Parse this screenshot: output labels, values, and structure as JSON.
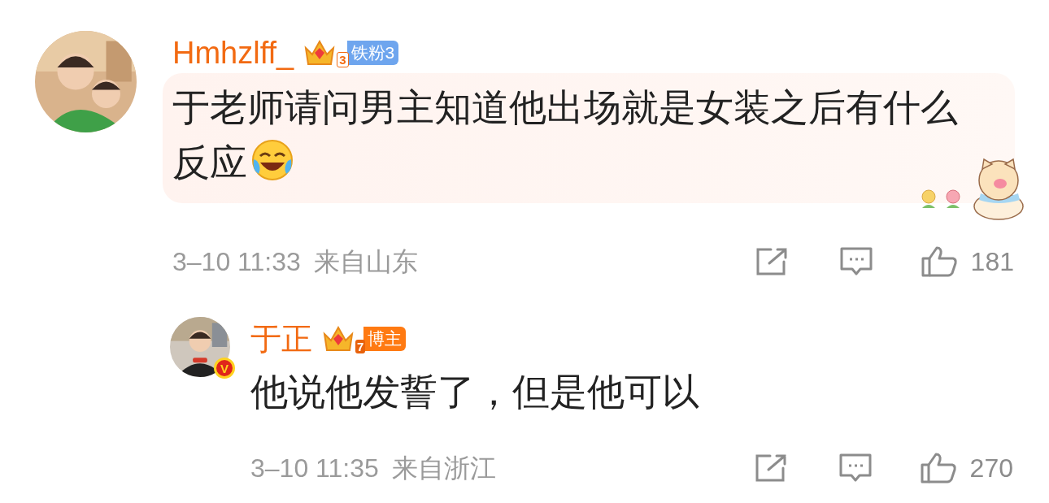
{
  "comments": [
    {
      "username": "Hmhzlff_",
      "badge": {
        "kind": "fan",
        "crown_level": "3",
        "label": "铁粉3"
      },
      "text": "于老师请问男主知道他出场就是女装之后有什么反应",
      "emoji": true,
      "bubble": true,
      "time": "3–10 11:33",
      "location": "来自山东",
      "likes": "181"
    },
    {
      "username": "于正",
      "badge": {
        "kind": "author",
        "crown_level": "7",
        "label": "博主"
      },
      "verified_mark": "V",
      "text": "他说他发誓了，但是他可以",
      "emoji": false,
      "bubble": false,
      "time": "3–10 11:35",
      "location": "来自浙江",
      "likes": "270"
    }
  ]
}
